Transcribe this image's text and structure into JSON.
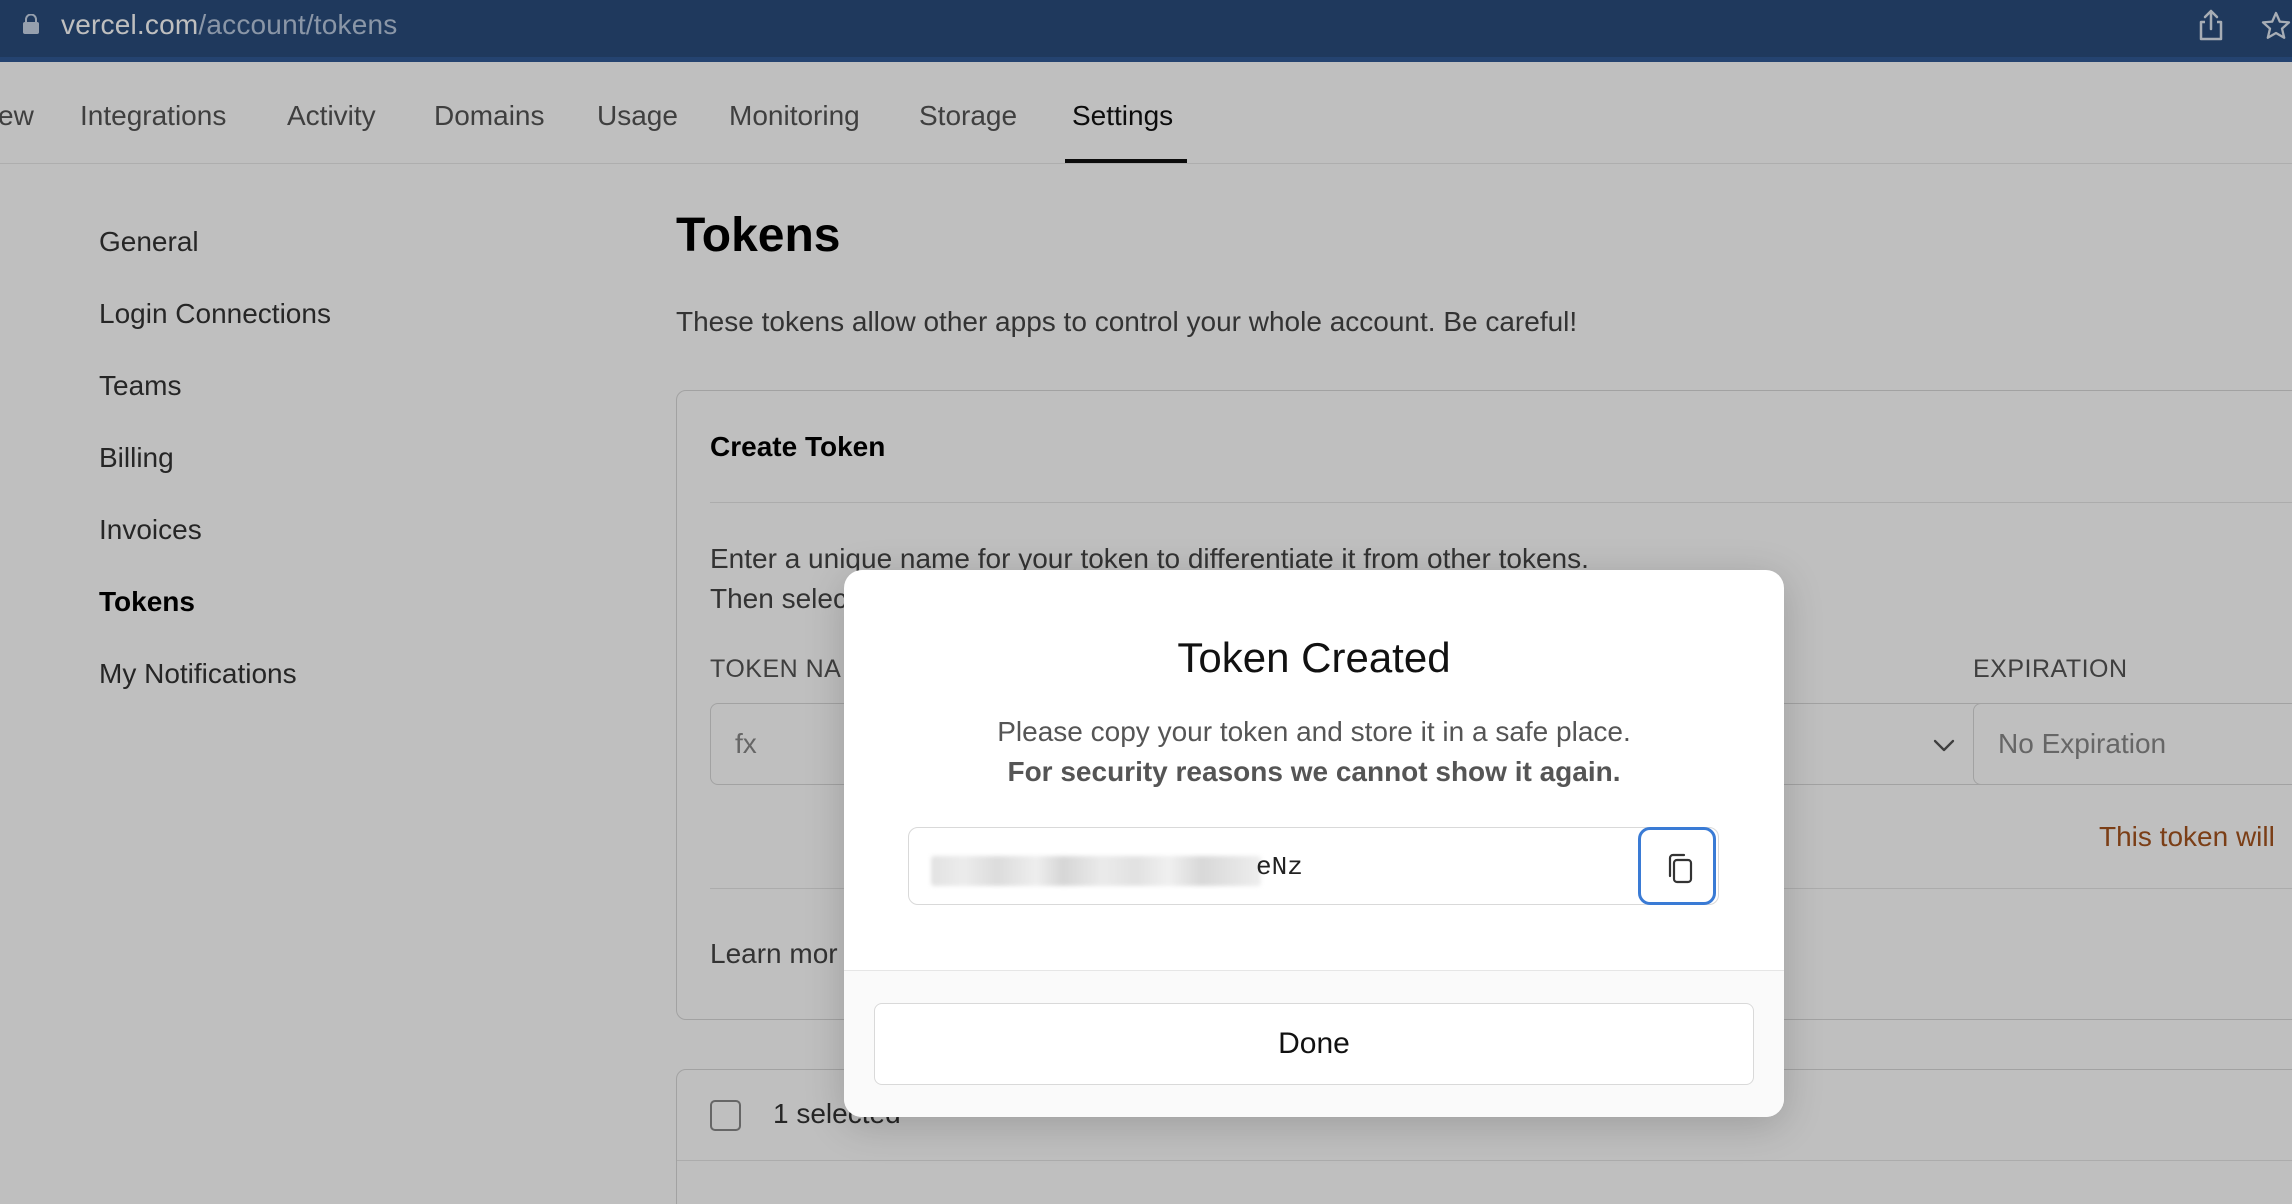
{
  "browser": {
    "url_host": "vercel.com",
    "url_path": "/account/tokens"
  },
  "nav": {
    "tabs": [
      {
        "label": "ew"
      },
      {
        "label": "Integrations"
      },
      {
        "label": "Activity"
      },
      {
        "label": "Domains"
      },
      {
        "label": "Usage"
      },
      {
        "label": "Monitoring"
      },
      {
        "label": "Storage"
      },
      {
        "label": "Settings"
      }
    ],
    "active_tab": "Settings"
  },
  "sidebar": {
    "items": [
      {
        "label": "General"
      },
      {
        "label": "Login Connections"
      },
      {
        "label": "Teams"
      },
      {
        "label": "Billing"
      },
      {
        "label": "Invoices"
      },
      {
        "label": "Tokens"
      },
      {
        "label": "My Notifications"
      }
    ],
    "active_item": "Tokens"
  },
  "main": {
    "title": "Tokens",
    "description": "These tokens allow other apps to control your whole account. Be careful!",
    "create_card": {
      "title": "Create Token",
      "text_line1": "Enter a unique name for your token to differentiate it from other tokens.",
      "text_line2": "Then selec",
      "token_name_label": "TOKEN NA",
      "token_name_value": "fx",
      "expiration_label": "EXPIRATION",
      "expiration_value": "No Expiration",
      "warning": "This token will",
      "learn_more": "Learn mor"
    },
    "list_card": {
      "selected_text": "1 selected"
    }
  },
  "modal": {
    "title": "Token Created",
    "line1": "Please copy your token and store it in a safe place.",
    "line2": "For security reasons we cannot show it again.",
    "token_visible_suffix": "eNz",
    "done_label": "Done"
  },
  "colors": {
    "urlbar": "#2a4d7c",
    "warning": "#a5531e",
    "copy_focus": "#3a7bd5"
  }
}
